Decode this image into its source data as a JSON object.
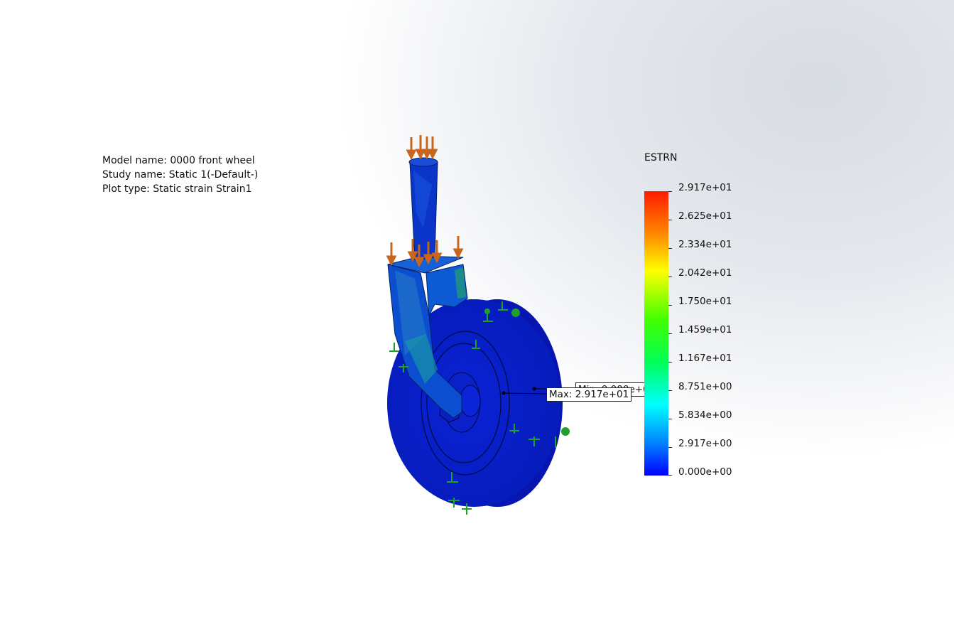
{
  "info": {
    "model_name": "Model name: 0000 front wheel",
    "study_name": "Study name: Static 1(-Default-)",
    "plot_type": "Plot type: Static strain Strain1"
  },
  "legend": {
    "title": "ESTRN",
    "labels": [
      "2.917e+01",
      "2.625e+01",
      "2.334e+01",
      "2.042e+01",
      "1.750e+01",
      "1.459e+01",
      "1.167e+01",
      "8.751e+00",
      "5.834e+00",
      "2.917e+00",
      "0.000e+00"
    ]
  },
  "probes": {
    "min_label": "Min: 0.000e+00",
    "max_label": "Max: 2.917e+01"
  },
  "colors": {
    "model_blue": "#0a1ec8",
    "load_arrow": "#c8661e",
    "fixture": "#1fa02a"
  },
  "icons": [
    "load-arrow-icon",
    "fixture-icon"
  ]
}
